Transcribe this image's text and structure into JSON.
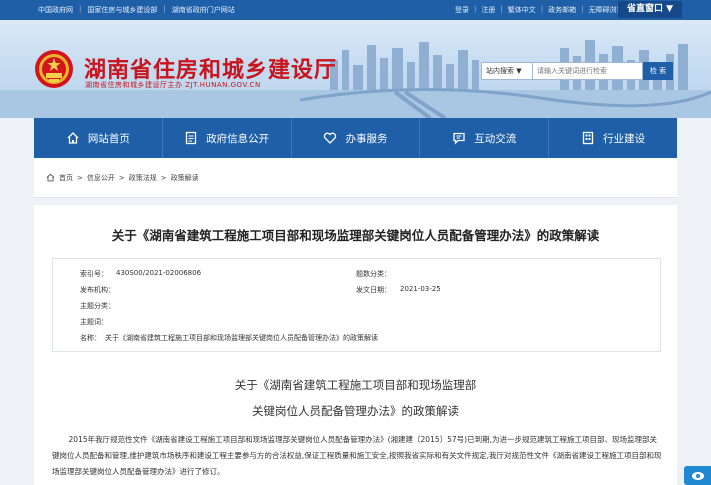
{
  "topbar": {
    "left_links": [
      "中国政府网",
      "国家住房与城乡建设部",
      "湖南省政府门户网站"
    ],
    "right_links": [
      "登录",
      "注册",
      "繁体中文",
      "政务邮箱",
      "无障碍浏览"
    ],
    "province_button": "省直窗口 ▼"
  },
  "header": {
    "title": "湖南省住房和城乡建设厅",
    "subtitle": "湖南省住房和城乡建设厅主办  ZJT.HUNAN.GOV.CN"
  },
  "search": {
    "scope": "站内搜索 ▼",
    "placeholder": "请输入关键词进行检索",
    "button": "检 索"
  },
  "nav": {
    "items": [
      {
        "label": "网站首页",
        "icon": "home-icon"
      },
      {
        "label": "政府信息公开",
        "icon": "document-icon"
      },
      {
        "label": "办事服务",
        "icon": "heart-icon"
      },
      {
        "label": "互动交流",
        "icon": "chat-icon"
      },
      {
        "label": "行业建设",
        "icon": "building-icon"
      }
    ]
  },
  "breadcrumb": {
    "items": [
      "首页",
      "信息公开",
      "政策法规",
      "政策解读"
    ],
    "separator": ">"
  },
  "article": {
    "title": "关于《湖南省建筑工程施工项目部和现场监理部关键岗位人员配备管理办法》的政策解读",
    "meta": {
      "index_label": "索引号：",
      "index_value": "430S00/2021-02006806",
      "category_label": "题数分类：",
      "publisher_label": "发布机构：",
      "date_label": "发文日期：",
      "date_value": "2021-03-25",
      "subject_label": "主题分类：",
      "keyword_label": "主题词：",
      "name_label": "名称：",
      "name_value": "关于《湖南省建筑工程施工项目部和现场监理部关键岗位人员配备管理办法》的政策解读"
    },
    "subtitle_line1": "关于《湖南省建筑工程施工项目部和现场监理部",
    "subtitle_line2": "关键岗位人员配备管理办法》的政策解读",
    "paragraph": "2015年我厅规范性文件《湖南省建设工程施工项目部和现场监理部关键岗位人员配备管理办法》(湘建建〔2015〕57号)已到期,为进一步规范建筑工程施工项目部、现场监理部关键岗位人员配备和管理,维护建筑市场秩序和建设工程主要参与方的合法权益,保证工程质量和施工安全,按照我省实际和有关文件规定,我厅对规范性文件《湖南省建设工程施工项目部和现场监理部关键岗位人员配备管理办法》进行了修订。"
  },
  "colors": {
    "primary_blue": "#1e5fa8",
    "title_red": "#c8141c",
    "float_button": "#1e88d2"
  }
}
